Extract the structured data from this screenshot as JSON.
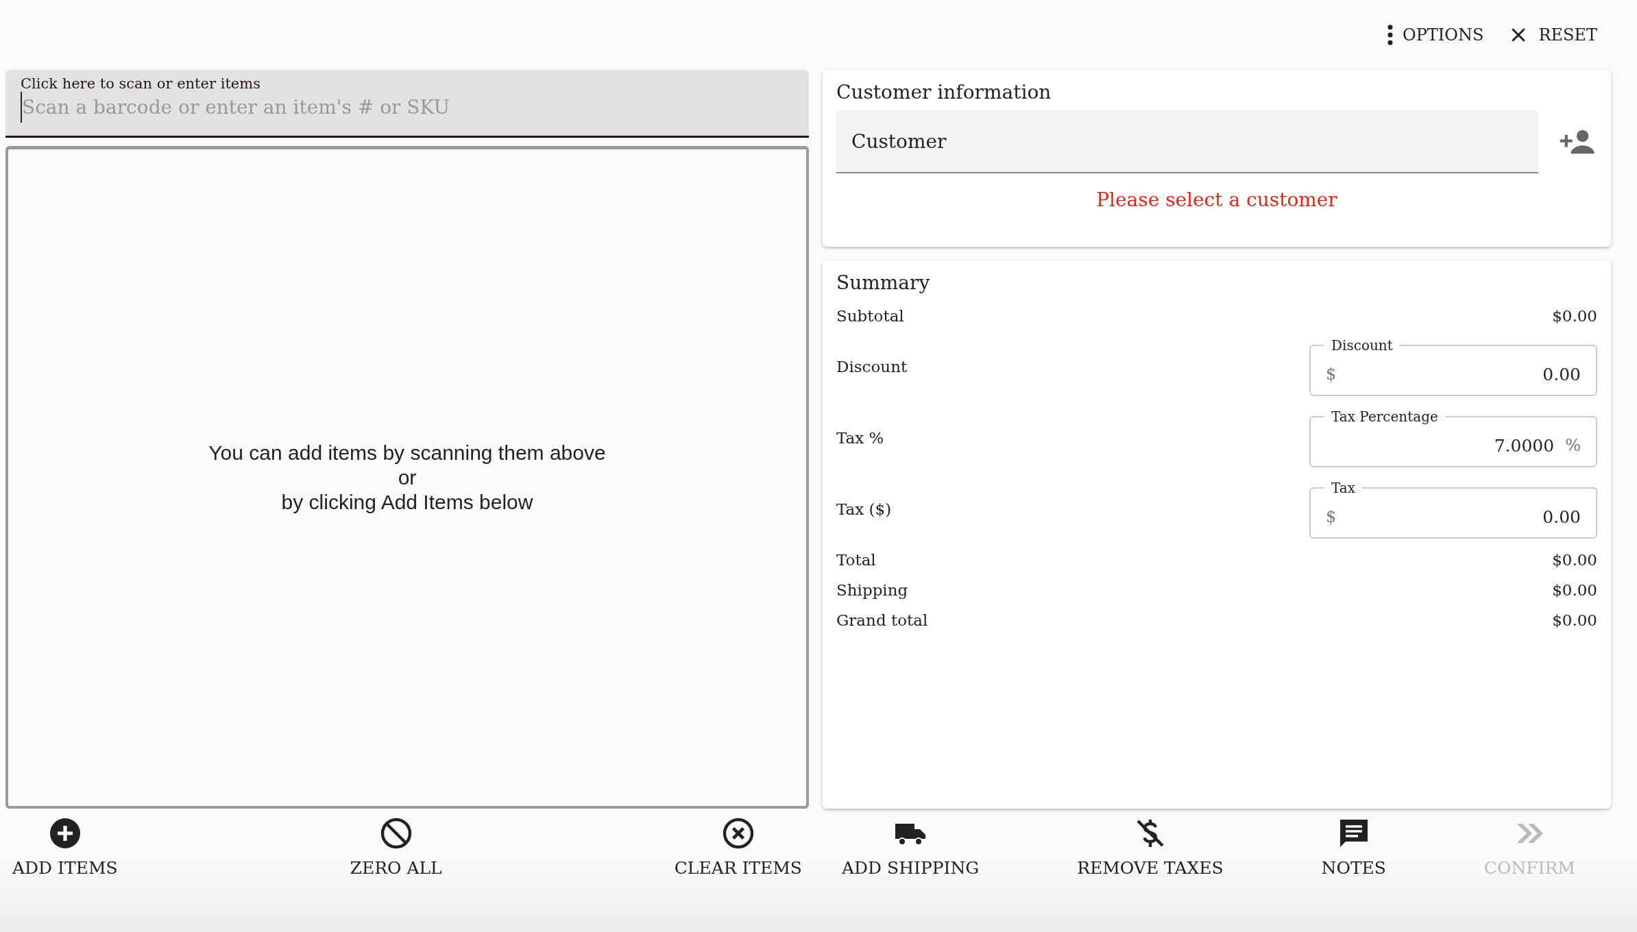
{
  "toolbar": [
    {
      "label": "OPTIONS"
    },
    {
      "label": "RESET"
    }
  ],
  "scan_field": {
    "label": "Click here to scan or enter items",
    "placeholder": "Scan a barcode or enter an item's # or SKU"
  },
  "items_empty_message": [
    "You can add items by scanning them above",
    "or",
    "by clicking Add Items below"
  ],
  "customer": {
    "title": "Customer information",
    "placeholder": "Customer",
    "error": "Please select a customer"
  },
  "summary": {
    "title": "Summary",
    "rows": [
      {
        "kind": "value",
        "label": "Subtotal",
        "value": "$0.00"
      },
      {
        "kind": "field",
        "label": "Discount",
        "field_label": "Discount",
        "prefix": "$",
        "value": "0.00"
      },
      {
        "kind": "field",
        "label": "Tax %",
        "field_label": "Tax Percentage",
        "suffix": "%",
        "value": "7.0000"
      },
      {
        "kind": "field",
        "label": "Tax ($)",
        "field_label": "Tax",
        "prefix": "$",
        "value": "0.00"
      },
      {
        "kind": "value",
        "label": "Total",
        "value": "$0.00"
      },
      {
        "kind": "value",
        "label": "Shipping",
        "value": "$0.00"
      },
      {
        "kind": "value",
        "label": "Grand total",
        "value": "$0.00"
      }
    ]
  },
  "actions": [
    {
      "kind": "add",
      "label": "ADD ITEMS",
      "disabled": false
    },
    {
      "kind": "zero",
      "label": "ZERO ALL",
      "disabled": false
    },
    {
      "kind": "clear",
      "label": "CLEAR ITEMS",
      "disabled": false
    },
    {
      "kind": "shipping",
      "label": "ADD SHIPPING",
      "disabled": false
    },
    {
      "kind": "taxes",
      "label": "REMOVE TAXES",
      "disabled": false
    },
    {
      "kind": "notes",
      "label": "NOTES",
      "disabled": false
    },
    {
      "kind": "confirm",
      "label": "CONFIRM",
      "disabled": true
    }
  ]
}
